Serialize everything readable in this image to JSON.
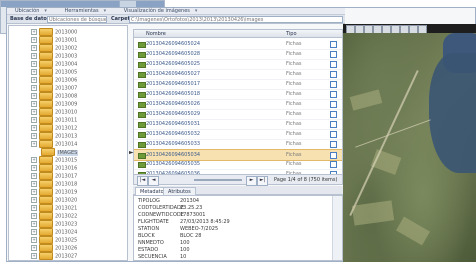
{
  "menu": {
    "items": [
      "Ubicación",
      "Herramientas",
      "Visualización de imágenes"
    ]
  },
  "dbbar": {
    "label": "Base de datos",
    "db_value": "Ubicaciones de búsqueda",
    "path_label": "Carpeta",
    "path_value": "C:\\Imagenes\\Ortofotos\\2013\\2013\\20130426\\images"
  },
  "tree": {
    "folders": [
      "2013000",
      "2013001",
      "2013002",
      "2013003",
      "2013004",
      "2013005",
      "2013006",
      "2013007",
      "2013008",
      "2013009",
      "2013010",
      "2013011",
      "2013012",
      "2013013",
      "2013014",
      "2013015",
      "2013016",
      "2013017",
      "2013018",
      "2013019",
      "2013020",
      "2013021",
      "2013022",
      "2013023",
      "2013024",
      "2013025",
      "2013026",
      "2013027"
    ],
    "selected_child": "IMAGES"
  },
  "list": {
    "col_name": "Nombre",
    "col_type": "Tipo",
    "rows": [
      {
        "name": "20130426094605024",
        "type": "Fichas"
      },
      {
        "name": "20130426094605028",
        "type": "Fichas"
      },
      {
        "name": "20130426094605025",
        "type": "Fichas"
      },
      {
        "name": "20130426094605027",
        "type": "Fichas"
      },
      {
        "name": "20130426094605017",
        "type": "Fichas"
      },
      {
        "name": "20130426094605018",
        "type": "Fichas"
      },
      {
        "name": "20130426094605026",
        "type": "Fichas"
      },
      {
        "name": "20130426094605029",
        "type": "Fichas"
      },
      {
        "name": "20130426094605031",
        "type": "Fichas"
      },
      {
        "name": "20130426094605032",
        "type": "Fichas"
      },
      {
        "name": "20130426094605033",
        "type": "Fichas"
      },
      {
        "name": "20130426094605034",
        "type": "Fichas"
      },
      {
        "name": "20130426094605035",
        "type": "Fichas"
      },
      {
        "name": "20130426094605036",
        "type": "Fichas"
      }
    ],
    "selected_index": 11
  },
  "pager": {
    "first": "|◄",
    "prev": "◄",
    "next": "►",
    "last": "►|",
    "text": "Page 1/4 of 8 (750 items)"
  },
  "details": {
    "tab_active": "Metadatos",
    "tab_other": "Atributos",
    "props": [
      {
        "k": "TIPOLOG",
        "v": "201304"
      },
      {
        "k": "CODTOLERTIDADE",
        "v": "23.25.23"
      },
      {
        "k": "CODNEWTIDCODE",
        "v": "17873001"
      },
      {
        "k": "FLIGHTDATE",
        "v": "27/03/2013 8:45:29"
      },
      {
        "k": "STATION",
        "v": "WEBEO-7/2025"
      },
      {
        "k": "BLOCK",
        "v": "BLOC 28"
      },
      {
        "k": "NNMEDTO",
        "v": "100"
      },
      {
        "k": "ESTADO",
        "v": "100"
      },
      {
        "k": "SECUENCIA",
        "v": "10"
      }
    ]
  },
  "colors": {
    "selected_row": "#f7e1b0",
    "link_blue": "#3c5a8a",
    "checkbox_blue": "#4a7fc4"
  }
}
